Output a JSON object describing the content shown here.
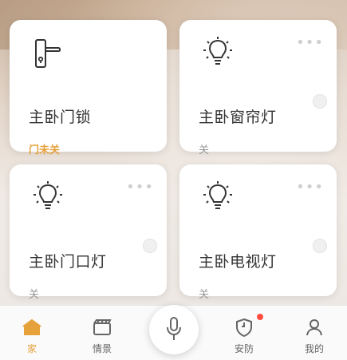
{
  "colors": {
    "accent": "#e6a13b",
    "badge": "#ff4b3e",
    "text": "#333333",
    "muted": "#999999"
  },
  "cards": [
    {
      "title": "主卧门锁",
      "status": "门未关",
      "icon": "door-lock-icon"
    },
    {
      "title": "主卧窗帘灯",
      "status": "关",
      "icon": "light-bulb-icon"
    },
    {
      "title": "主卧门口灯",
      "status": "关",
      "icon": "light-bulb-icon"
    },
    {
      "title": "主卧电视灯",
      "status": "关",
      "icon": "light-bulb-icon"
    }
  ],
  "tabs": [
    {
      "label": "家",
      "icon": "home-icon"
    },
    {
      "label": "情景",
      "icon": "scene-icon"
    },
    {
      "label": "安防",
      "icon": "security-shield-icon"
    },
    {
      "label": "我的",
      "icon": "profile-icon"
    }
  ],
  "mic": {
    "icon": "microphone-icon"
  }
}
